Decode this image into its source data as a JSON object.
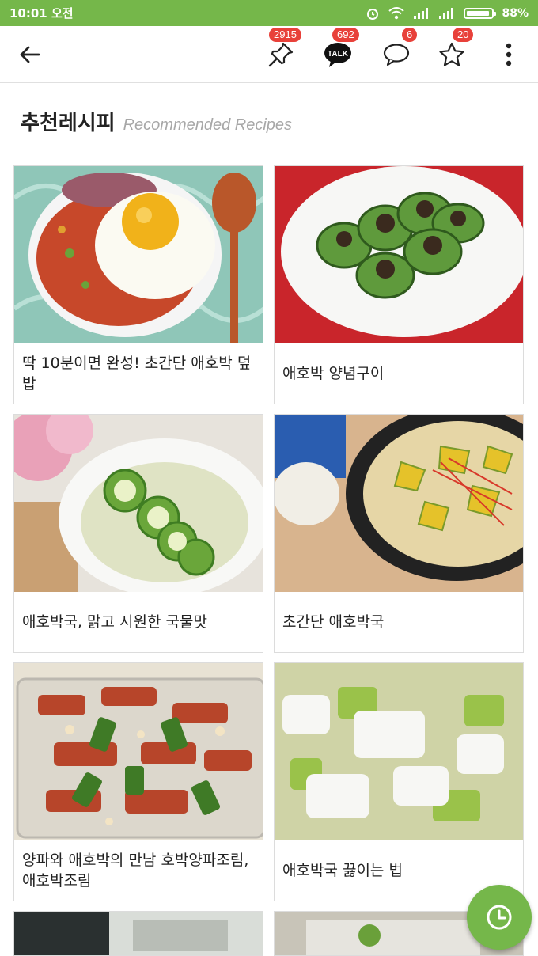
{
  "status_bar": {
    "time": "10:01 오전",
    "battery": "88%"
  },
  "toolbar": {
    "pin_count": "2915",
    "talk_count": "692",
    "comment_count": "6",
    "star_count": "20",
    "talk_label": "TALK"
  },
  "heading": {
    "title": "추천레시피",
    "subtitle": "Recommended Recipes"
  },
  "recipes": [
    {
      "title": "딱 10분이면 완성! 초간단 애호박 덮밥"
    },
    {
      "title": "애호박 양념구이"
    },
    {
      "title": "애호박국, 맑고 시원한 국물맛"
    },
    {
      "title": "초간단 애호박국"
    },
    {
      "title": "양파와 애호박의 만남 호박양파조림, 애호박조림"
    },
    {
      "title": "애호박국 끓이는 법"
    }
  ],
  "colors": {
    "brand": "#75b74a",
    "badge": "#e8413a"
  }
}
